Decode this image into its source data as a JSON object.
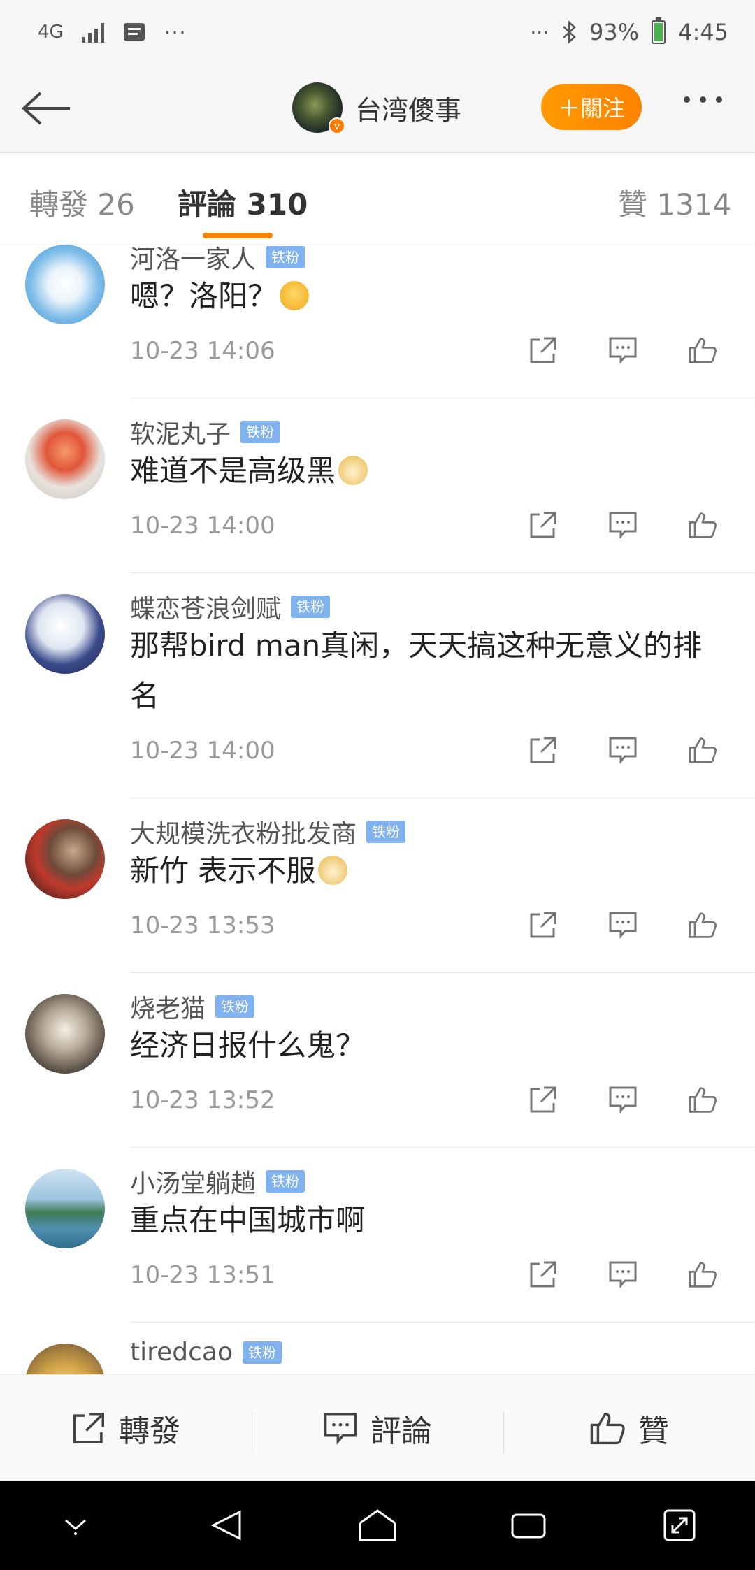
{
  "status_bar": {
    "network": "4G",
    "battery_percent": "93%",
    "time": "4:45"
  },
  "header": {
    "title": "台湾傻事",
    "follow_label": "＋關注"
  },
  "tabs": {
    "repost": "轉發 26",
    "comments": "評論 310",
    "likes": "贊 1314"
  },
  "comments": [
    {
      "username": "河洛一家人",
      "badge": "铁粉",
      "text": "嗯？洛阳？",
      "time": "10-23 14:06"
    },
    {
      "username": "软泥丸子",
      "badge": "铁粉",
      "text": "难道不是高级黑",
      "time": "10-23 14:00"
    },
    {
      "username": "蝶恋苍浪剑赋",
      "badge": "铁粉",
      "text": "那帮bird man真闲，天天搞这种无意义的排名",
      "time": "10-23 14:00"
    },
    {
      "username": "大规模洗衣粉批发商",
      "badge": "铁粉",
      "text": "新竹 表示不服",
      "time": "10-23 13:53"
    },
    {
      "username": "烧老猫",
      "badge": "铁粉",
      "text": "经济日报什么鬼？",
      "time": "10-23 13:52"
    },
    {
      "username": "小汤堂躺趟",
      "badge": "铁粉",
      "text": "重点在中国城市啊",
      "time": "10-23 13:51"
    },
    {
      "username": "tiredcao",
      "badge": "铁粉",
      "text": "",
      "time": ""
    }
  ],
  "bottom_bar": {
    "repost": "轉發",
    "comment": "評論",
    "like": "贊"
  },
  "colors": {
    "accent": "#ff8200",
    "badge": "#7fb2ef"
  }
}
